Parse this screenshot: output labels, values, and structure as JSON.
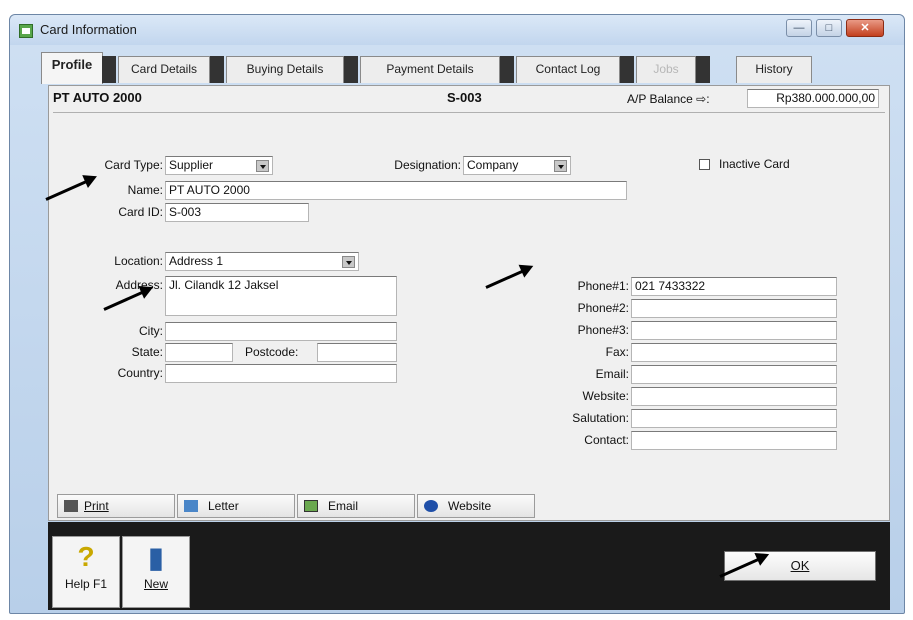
{
  "window": {
    "title": "Card Information",
    "minimize": "—",
    "maximize": "□",
    "close": "✕"
  },
  "tabs": [
    {
      "label": "Profile"
    },
    {
      "label": "Card Details"
    },
    {
      "label": "Buying Details"
    },
    {
      "label": "Payment Details"
    },
    {
      "label": "Contact Log"
    },
    {
      "label": "Jobs"
    },
    {
      "label": "History"
    }
  ],
  "header": {
    "company": "PT AUTO 2000",
    "card_code": "S-003",
    "balance_label": "A/P Balance ⇨:",
    "balance_value": "Rp380.000.000,00"
  },
  "profile": {
    "card_type_label": "Card Type:",
    "card_type_value": "Supplier",
    "designation_label": "Designation:",
    "designation_value": "Company",
    "inactive_label": "Inactive Card",
    "name_label": "Name:",
    "name_value": "PT AUTO 2000",
    "card_id_label": "Card ID:",
    "card_id_value": "S-003",
    "location_label": "Location:",
    "location_value": "Address 1",
    "address_label": "Address:",
    "address_value": "Jl. Cilandk 12 Jaksel",
    "city_label": "City:",
    "city_value": "",
    "state_label": "State:",
    "state_value": "",
    "postcode_label": "Postcode:",
    "postcode_value": "",
    "country_label": "Country:",
    "country_value": ""
  },
  "contact": {
    "phone1_label": "Phone#1:",
    "phone1_value": "021 7433322",
    "phone2_label": "Phone#2:",
    "phone3_label": "Phone#3:",
    "fax_label": "Fax:",
    "email_label": "Email:",
    "website_label": "Website:",
    "salutation_label": "Salutation:",
    "contact_label": "Contact:"
  },
  "actions": {
    "print": "Print",
    "letter": "Letter",
    "email": "Email",
    "website": "Website"
  },
  "toolbar": {
    "help": "Help F1",
    "new": "New",
    "ok": "OK"
  }
}
